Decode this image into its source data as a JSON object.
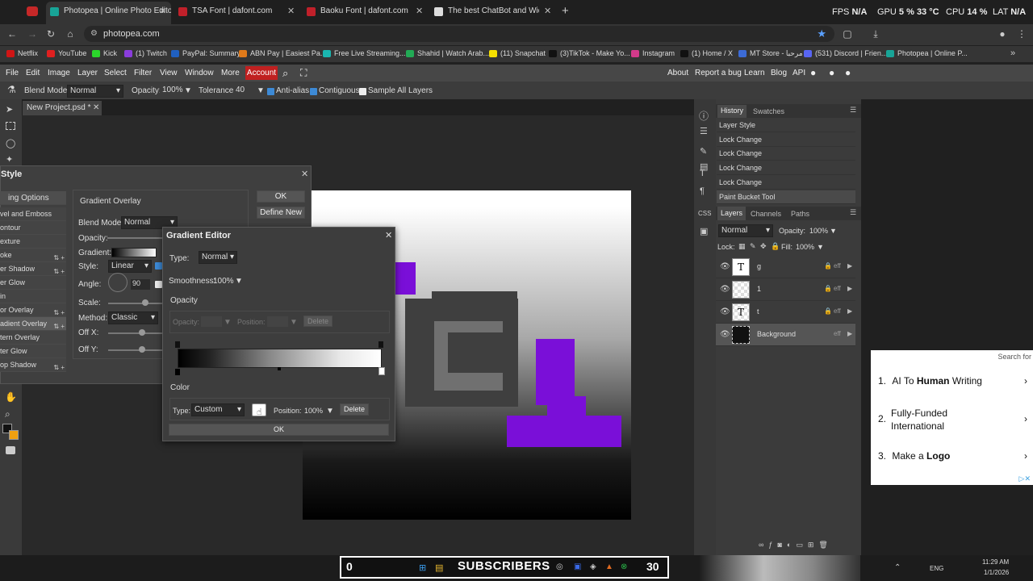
{
  "browser": {
    "tabs": [
      {
        "label": "Photopea | Online Photo Editor",
        "active": true
      },
      {
        "label": "TSA Font | dafont.com"
      },
      {
        "label": "Baoku Font | dafont.com"
      },
      {
        "label": "The best ChatBot and Widgets"
      }
    ],
    "new_tab": "+",
    "url": "photopea.com",
    "sys": {
      "fps_label": "FPS",
      "fps": "N/A",
      "gpu_label": "GPU",
      "gpu": "5 %",
      "gpu_temp": "33 °C",
      "cpu_label": "CPU",
      "cpu": "14 %",
      "lat_label": "LAT",
      "lat": "N/A"
    },
    "bookmarks": [
      "Netflix",
      "YouTube",
      "Kick",
      "(1) Twitch",
      "PayPal: Summary",
      "ABN Pay | Easiest Pa...",
      "Free Live Streaming...",
      "Shahid | Watch Arab...",
      "(11) Snapchat",
      "(3)TikTok - Make Yo...",
      "Instagram",
      "(1) Home / X",
      "MT Store - مرحبا",
      "(531) Discord | Frien...",
      "Photopea | Online P..."
    ]
  },
  "menu": {
    "items": [
      "File",
      "Edit",
      "Image",
      "Layer",
      "Select",
      "Filter",
      "View",
      "Window",
      "More"
    ],
    "account": "Account",
    "right": [
      "About",
      "Report a bug",
      "Learn",
      "Blog",
      "API"
    ]
  },
  "options": {
    "blend_label": "Blend Mode:",
    "blend": "Normal",
    "opacity_label": "Opacity:",
    "opacity": "100%",
    "tolerance_label": "Tolerance:",
    "tolerance": "40",
    "antialias": "Anti-alias",
    "contiguous": "Contiguous",
    "sample_all": "Sample All Layers"
  },
  "document": {
    "tab": "New Project.psd *"
  },
  "layer_style": {
    "title": "Style",
    "items": [
      "Blending Options",
      "Bevel and Emboss",
      "Contour",
      "Texture",
      "Stroke",
      "Inner Shadow",
      "Inner Glow",
      "Satin",
      "Color Overlay",
      "Gradient Overlay",
      "Pattern Overlay",
      "Outer Glow",
      "Drop Shadow"
    ],
    "items_visible": [
      "ing Options",
      "vel and Emboss",
      "ontour",
      "exture",
      "oke",
      "er Shadow",
      "er Glow",
      "in",
      "or Overlay",
      "adient Overlay",
      "tern Overlay",
      "ter Glow",
      "op Shadow"
    ],
    "section": "Gradient Overlay",
    "blend_label": "Blend Mode:",
    "blend": "Normal",
    "opacity_label": "Opacity:",
    "gradient_label": "Gradient:",
    "style_label": "Style:",
    "style": "Linear",
    "angle_label": "Angle:",
    "angle": "90",
    "scale_label": "Scale:",
    "method_label": "Method:",
    "method": "Classic",
    "offx_label": "Off X:",
    "offy_label": "Off Y:",
    "ok": "OK",
    "define_new": "Define New"
  },
  "gradient_editor": {
    "title": "Gradient Editor",
    "type_label": "Type:",
    "type": "Normal",
    "smooth_label": "Smoothness:",
    "smooth": "100%",
    "opacity_section": "Opacity",
    "op_label": "Opacity:",
    "pos_label": "Position:",
    "delete": "Delete",
    "color_section": "Color",
    "ctype_label": "Type:",
    "ctype": "Custom",
    "cpos_label": "Position:",
    "cpos": "100%",
    "cdelete": "Delete",
    "ok": "OK"
  },
  "history": {
    "tabs": [
      "History",
      "Swatches"
    ],
    "items": [
      "Layer Style",
      "Lock Change",
      "Lock Change",
      "Lock Change",
      "Lock Change",
      "Paint Bucket Tool"
    ]
  },
  "layers": {
    "tabs": [
      "Layers",
      "Channels",
      "Paths"
    ],
    "blend": "Normal",
    "opacity_label": "Opacity:",
    "opacity": "100%",
    "lock_label": "Lock:",
    "fill_label": "Fill:",
    "fill": "100%",
    "rows": [
      {
        "name": "g",
        "thumb": "T"
      },
      {
        "name": "1",
        "thumb": ""
      },
      {
        "name": "t",
        "thumb": "T"
      },
      {
        "name": "Background",
        "thumb": ""
      }
    ],
    "eff": "eff"
  },
  "ad": {
    "search": "Search for",
    "items": [
      {
        "num": "1.",
        "pre": "AI To ",
        "bold": "Human",
        "post": " Writing"
      },
      {
        "num": "2.",
        "pre": "Fully-Funded International",
        "bold": "",
        "post": ""
      },
      {
        "num": "3.",
        "pre": "Make a ",
        "bold": "Logo",
        "post": ""
      }
    ]
  },
  "taskbar": {
    "left": "0",
    "text": "SUBSCRIBERS",
    "right": "30",
    "lang": "ENG",
    "time": "11:29 AM",
    "date": "1/1/2026"
  }
}
